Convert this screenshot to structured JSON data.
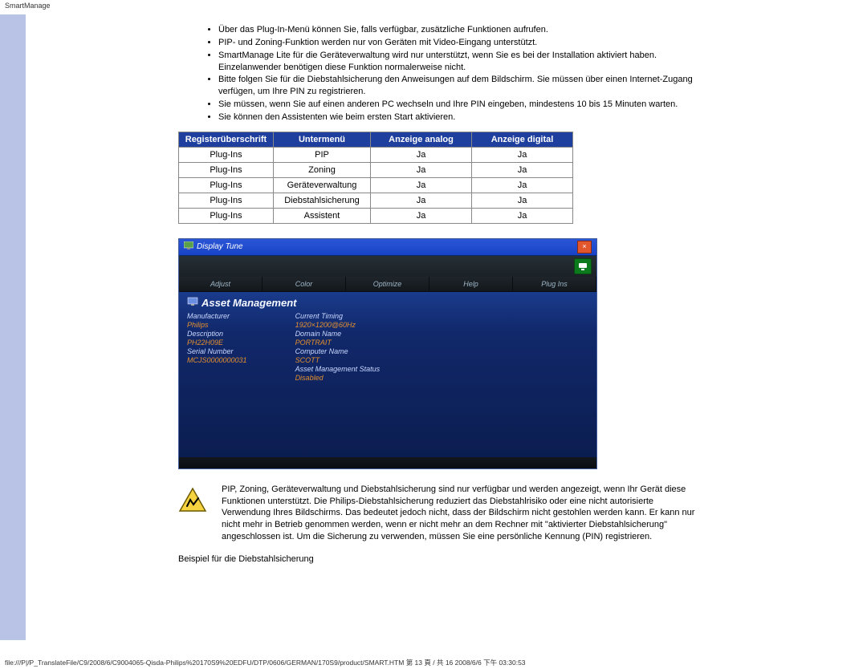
{
  "page_label": "SmartManage",
  "bullets": [
    "Über das Plug-In-Menü können Sie, falls verfügbar, zusätzliche Funktionen aufrufen.",
    "PIP- und Zoning-Funktion werden nur von Geräten mit Video-Eingang unterstützt.",
    "SmartManage Lite für die Geräteverwaltung wird nur unterstützt, wenn Sie es bei der Installation aktiviert haben. Einzelanwender benötigen diese Funktion normalerweise nicht.",
    "Bitte folgen Sie für die Diebstahlsicherung den Anweisungen auf dem Bildschirm. Sie müssen über einen Internet-Zugang verfügen, um Ihre PIN zu registrieren.",
    "Sie müssen, wenn Sie auf einen anderen PC wechseln und Ihre PIN eingeben, mindestens 10 bis 15 Minuten warten.",
    "Sie können den Assistenten wie beim ersten Start aktivieren."
  ],
  "table": {
    "headers": [
      "Registerüberschrift",
      "Untermenü",
      "Anzeige analog",
      "Anzeige digital"
    ],
    "rows": [
      [
        "Plug-Ins",
        "PIP",
        "Ja",
        "Ja"
      ],
      [
        "Plug-Ins",
        "Zoning",
        "Ja",
        "Ja"
      ],
      [
        "Plug-Ins",
        "Geräteverwaltung",
        "Ja",
        "Ja"
      ],
      [
        "Plug-Ins",
        "Diebstahlsicherung",
        "Ja",
        "Ja"
      ],
      [
        "Plug-Ins",
        "Assistent",
        "Ja",
        "Ja"
      ]
    ]
  },
  "panel": {
    "title": "Display Tune",
    "tabs": [
      "Adjust",
      "Color",
      "Optimize",
      "Help",
      "Plug Ins"
    ],
    "heading": "Asset Management",
    "left_col": [
      {
        "label": "Manufacturer",
        "value": "Philips"
      },
      {
        "label": "Description",
        "value": "PH22H09E"
      },
      {
        "label": "Serial Number",
        "value": "MCJS0000000031"
      }
    ],
    "right_col": [
      {
        "label": "Current Timing",
        "value": "1920×1200@60Hz"
      },
      {
        "label": "Domain Name",
        "value": "PORTRAIT"
      },
      {
        "label": "Computer Name",
        "value": "SCOTT"
      },
      {
        "label": "Asset Management Status",
        "value": "Disabled"
      }
    ]
  },
  "warning_text": "PIP, Zoning, Geräteverwaltung und Diebstahlsicherung sind nur verfügbar und werden angezeigt, wenn Ihr Gerät diese Funktionen unterstützt. Die Philips-Diebstahlsicherung reduziert das Diebstahlrisiko oder eine nicht autorisierte Verwendung Ihres Bildschirms. Das bedeutet jedoch nicht, dass der Bildschirm nicht gestohlen werden kann. Er kann nur nicht mehr in Betrieb genommen werden, wenn er nicht mehr an dem Rechner mit \"aktivierter Diebstahlsicherung\" angeschlossen ist. Um die Sicherung zu verwenden, müssen Sie eine persönliche Kennung (PIN) registrieren.",
  "caption": "Beispiel für die Diebstahlsicherung",
  "footer": "file:///P|/P_TranslateFile/C9/2008/6/C9004065-Qisda-Philips%20170S9%20EDFU/DTP/0606/GERMAN/170S9/product/SMART.HTM 第 13 頁 / 共 16 2008/6/6 下午 03:30:53"
}
